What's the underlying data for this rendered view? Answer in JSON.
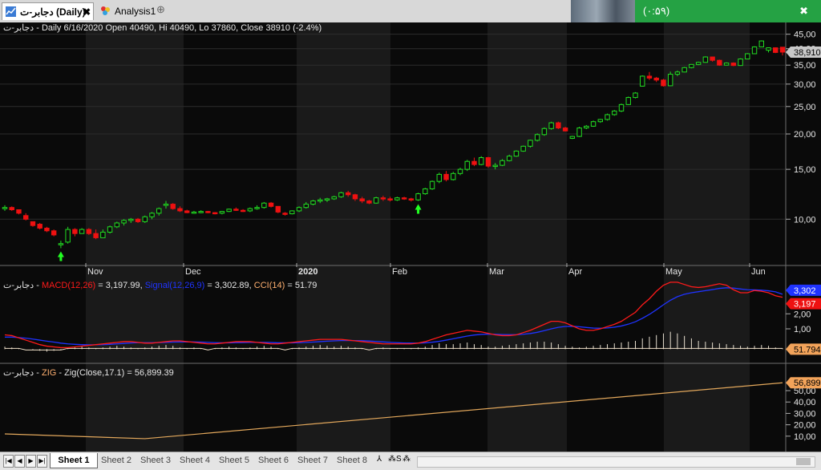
{
  "tabs": [
    {
      "label": "دجابر-ت (Daily)",
      "close": "✖",
      "active": true
    },
    {
      "label": "Analysis1",
      "active": false
    }
  ],
  "tab_add_icon": "⊕",
  "notification": {
    "text": "(۰:۵۹)",
    "close": "✖"
  },
  "pane1": {
    "header": "دجابر-ت - Daily 6/16/2020 Open 40490, Hi 40490, Lo 37860, Close 38910 (-2.4%)",
    "price_badge": "38,910"
  },
  "pane2": {
    "prefix": "دجابر-ت - ",
    "macd_label": "MACD(12,26)",
    "macd_value": " = 3,197.99, ",
    "signal_label": "Signal(12,26,9)",
    "signal_value": " = 3,302.89, ",
    "cci_label": "CCI(14)",
    "cci_value": " = 51.79",
    "badge_signal": "3,302",
    "badge_macd": "3,197",
    "badge_cci": "51.794"
  },
  "pane3": {
    "prefix": "دجابر-ت - ",
    "zig_label": "ZIG",
    "zig_rest": " - Zig(Close,17.1) = 56,899.39",
    "badge": "56,899"
  },
  "x_labels": [
    "Nov",
    "Dec",
    "2020",
    "Feb",
    "Mar",
    "Apr",
    "May",
    "Jun"
  ],
  "y1_ticks": [
    "45,00",
    "40,00",
    "35,00",
    "30,00",
    "25,00",
    "20,00",
    "15,00",
    "10,00"
  ],
  "y2_ticks": [
    "2,00",
    "1,00"
  ],
  "y3_ticks": [
    "50,00",
    "40,00",
    "30,00",
    "20,00",
    "10,00"
  ],
  "sheets": [
    "Sheet 1",
    "Sheet 2",
    "Sheet 3",
    "Sheet 4",
    "Sheet 5",
    "Sheet 6",
    "Sheet 7",
    "Sheet 8"
  ],
  "sheet_buttons": [
    "⅄",
    "⁂S",
    "⁂"
  ],
  "nav_buttons": [
    "|◀",
    "◀",
    "▶",
    "▶|"
  ],
  "colors": {
    "up": "#22dd22",
    "down": "#ee1111",
    "macd": "#ff1a1a",
    "signal": "#1f33ff",
    "cci": "#f0e0c8",
    "zig": "#e3a85c",
    "badge_price": "#c8c8c8",
    "badge_signal": "#1f33ff",
    "badge_macd": "#ee1111",
    "badge_orange": "#f2a35a"
  },
  "chart_data": {
    "type": "candlestick",
    "y_scale": "log",
    "ylim": [
      7000,
      47000
    ],
    "candles": [
      [
        10900,
        11200,
        10700,
        11000
      ],
      [
        11000,
        11100,
        10700,
        10800
      ],
      [
        10800,
        10800,
        10400,
        10500
      ],
      [
        10300,
        10500,
        9900,
        10000
      ],
      [
        9800,
        9800,
        9400,
        9500
      ],
      [
        9600,
        9700,
        9200,
        9300
      ],
      [
        9300,
        9400,
        9000,
        9100
      ],
      [
        9100,
        9200,
        8700,
        8800
      ],
      [
        8200,
        8400,
        7900,
        8200
      ],
      [
        8300,
        9400,
        8200,
        9200
      ],
      [
        9200,
        9300,
        8700,
        8900
      ],
      [
        8900,
        9300,
        8900,
        9200
      ],
      [
        9200,
        9300,
        8800,
        8900
      ],
      [
        8900,
        9200,
        8500,
        8600
      ],
      [
        8600,
        9200,
        8600,
        9000
      ],
      [
        9000,
        9500,
        8900,
        9400
      ],
      [
        9400,
        9800,
        9300,
        9700
      ],
      [
        9700,
        10000,
        9500,
        9900
      ],
      [
        9900,
        10100,
        9700,
        10000
      ],
      [
        10000,
        10100,
        9700,
        9800
      ],
      [
        9800,
        10300,
        9700,
        10200
      ],
      [
        10200,
        10600,
        10000,
        10500
      ],
      [
        10500,
        11000,
        10300,
        10900
      ],
      [
        11200,
        11600,
        10900,
        11300
      ],
      [
        11300,
        11400,
        10800,
        10900
      ],
      [
        10900,
        11100,
        10600,
        10700
      ],
      [
        10700,
        10800,
        10500,
        10550
      ],
      [
        10550,
        10700,
        10450,
        10600
      ],
      [
        10600,
        10750,
        10500,
        10650
      ],
      [
        10650,
        10700,
        10500,
        10550
      ],
      [
        10550,
        10600,
        10400,
        10500
      ],
      [
        10500,
        10700,
        10400,
        10650
      ],
      [
        10650,
        10900,
        10600,
        10850
      ],
      [
        10850,
        11000,
        10700,
        10750
      ],
      [
        10750,
        10850,
        10600,
        10700
      ],
      [
        10700,
        11000,
        10600,
        10900
      ],
      [
        10900,
        11200,
        10800,
        11000
      ],
      [
        11000,
        11500,
        10900,
        11400
      ],
      [
        11400,
        11500,
        11000,
        11100
      ],
      [
        11100,
        11100,
        10500,
        10600
      ],
      [
        10500,
        10600,
        10300,
        10450
      ],
      [
        10450,
        10750,
        10400,
        10700
      ],
      [
        10700,
        11100,
        10600,
        11000
      ],
      [
        11000,
        11500,
        10900,
        11300
      ],
      [
        11300,
        11700,
        11200,
        11600
      ],
      [
        11600,
        11900,
        11400,
        11700
      ],
      [
        11700,
        11900,
        11500,
        11800
      ],
      [
        11800,
        12100,
        11700,
        12000
      ],
      [
        12000,
        12500,
        11900,
        12400
      ],
      [
        12400,
        12600,
        12000,
        12200
      ],
      [
        12200,
        12300,
        11600,
        11800
      ],
      [
        11800,
        12000,
        11400,
        11600
      ],
      [
        11600,
        11700,
        11300,
        11400
      ],
      [
        11400,
        12000,
        11350,
        11900
      ],
      [
        11900,
        12100,
        11600,
        11800
      ],
      [
        11800,
        12000,
        11550,
        11700
      ],
      [
        11700,
        12000,
        11600,
        11900
      ],
      [
        11900,
        12000,
        11700,
        11800
      ],
      [
        11800,
        11900,
        11550,
        11700
      ],
      [
        11700,
        12400,
        11600,
        12300
      ],
      [
        12300,
        12900,
        12200,
        12800
      ],
      [
        12800,
        13700,
        12700,
        13600
      ],
      [
        13600,
        14600,
        13400,
        14400
      ],
      [
        14400,
        14800,
        13600,
        13800
      ],
      [
        13800,
        14700,
        13700,
        14500
      ],
      [
        14500,
        15200,
        14300,
        15000
      ],
      [
        15000,
        16200,
        14800,
        16000
      ],
      [
        16000,
        16500,
        15400,
        15600
      ],
      [
        15600,
        16700,
        15500,
        16500
      ],
      [
        16500,
        16600,
        15200,
        15400
      ],
      [
        15400,
        15800,
        15000,
        15500
      ],
      [
        15500,
        16300,
        15400,
        16100
      ],
      [
        16100,
        16900,
        16000,
        16700
      ],
      [
        16700,
        17500,
        16600,
        17400
      ],
      [
        17400,
        18200,
        17300,
        18100
      ],
      [
        18100,
        19100,
        17900,
        19000
      ],
      [
        19000,
        20100,
        18800,
        19900
      ],
      [
        19900,
        21100,
        19700,
        20900
      ],
      [
        20900,
        22100,
        20700,
        21900
      ],
      [
        21900,
        22100,
        20800,
        21000
      ],
      [
        21000,
        21200,
        20400,
        20500
      ],
      [
        19300,
        19700,
        19200,
        19600
      ],
      [
        19600,
        21200,
        19500,
        21000
      ],
      [
        21000,
        21500,
        20800,
        21300
      ],
      [
        21300,
        22300,
        21200,
        22100
      ],
      [
        22100,
        22600,
        21900,
        22500
      ],
      [
        22500,
        23600,
        22300,
        23400
      ],
      [
        23400,
        24300,
        23200,
        24100
      ],
      [
        24100,
        25600,
        23900,
        25400
      ],
      [
        25400,
        27100,
        25300,
        26900
      ],
      [
        26900,
        28100,
        26700,
        27900
      ],
      [
        29500,
        32200,
        29400,
        32000
      ],
      [
        32000,
        33100,
        31000,
        31500
      ],
      [
        31500,
        31800,
        30500,
        31000
      ],
      [
        31000,
        31300,
        29400,
        29600
      ],
      [
        29600,
        33200,
        29500,
        32500
      ],
      [
        32500,
        33500,
        32000,
        33100
      ],
      [
        33100,
        34500,
        33000,
        34300
      ],
      [
        34300,
        35300,
        34100,
        35200
      ],
      [
        35200,
        36000,
        35000,
        35800
      ],
      [
        35800,
        37600,
        35700,
        37400
      ],
      [
        37400,
        37500,
        36000,
        36400
      ],
      [
        36400,
        36600,
        34800,
        35000
      ],
      [
        35000,
        35800,
        34900,
        35600
      ],
      [
        35600,
        35800,
        34700,
        34900
      ],
      [
        34900,
        37000,
        34800,
        36800
      ],
      [
        36800,
        38600,
        36700,
        38400
      ],
      [
        38400,
        40800,
        38300,
        40600
      ],
      [
        40600,
        42800,
        40500,
        42600
      ],
      [
        39500,
        40400,
        38800,
        40300
      ],
      [
        40300,
        40400,
        38600,
        38800
      ],
      [
        40490,
        40490,
        37860,
        38910
      ]
    ],
    "signals": [
      {
        "index": 8,
        "type": "buy"
      },
      {
        "index": 59,
        "type": "buy"
      }
    ],
    "macd": [
      0.6,
      0.55,
      0.4,
      0.25,
      0.1,
      -0.05,
      -0.15,
      -0.2,
      -0.25,
      -0.25,
      -0.2,
      -0.15,
      -0.1,
      -0.05,
      0.0,
      0.05,
      0.1,
      0.15,
      0.15,
      0.1,
      0.05,
      0.05,
      0.1,
      0.15,
      0.2,
      0.2,
      0.15,
      0.1,
      0.05,
      0.0,
      0.0,
      0.05,
      0.1,
      0.15,
      0.15,
      0.15,
      0.1,
      0.05,
      0.0,
      0.0,
      0.05,
      0.1,
      0.15,
      0.2,
      0.25,
      0.3,
      0.3,
      0.3,
      0.3,
      0.25,
      0.2,
      0.15,
      0.1,
      0.05,
      0.0,
      0.0,
      0.0,
      0.0,
      0.0,
      0.05,
      0.15,
      0.3,
      0.45,
      0.6,
      0.7,
      0.8,
      0.9,
      0.85,
      0.8,
      0.7,
      0.6,
      0.55,
      0.55,
      0.6,
      0.75,
      0.9,
      1.1,
      1.3,
      1.5,
      1.5,
      1.4,
      1.2,
      1.0,
      0.9,
      0.9,
      1.0,
      1.15,
      1.3,
      1.5,
      1.8,
      2.1,
      2.6,
      3.0,
      3.5,
      3.9,
      4.1,
      4.1,
      3.95,
      3.8,
      3.75,
      3.8,
      3.9,
      4.0,
      3.9,
      3.6,
      3.4,
      3.4,
      3.55,
      3.5,
      3.4,
      3.2,
      3.1
    ],
    "signal": [
      0.45,
      0.45,
      0.42,
      0.38,
      0.32,
      0.25,
      0.18,
      0.12,
      0.05,
      0.0,
      -0.03,
      -0.05,
      -0.06,
      -0.06,
      -0.05,
      -0.03,
      0.0,
      0.03,
      0.06,
      0.08,
      0.08,
      0.08,
      0.09,
      0.1,
      0.12,
      0.13,
      0.13,
      0.13,
      0.12,
      0.1,
      0.08,
      0.07,
      0.07,
      0.08,
      0.09,
      0.1,
      0.1,
      0.1,
      0.09,
      0.07,
      0.07,
      0.07,
      0.08,
      0.1,
      0.12,
      0.15,
      0.18,
      0.2,
      0.22,
      0.23,
      0.22,
      0.21,
      0.19,
      0.16,
      0.13,
      0.1,
      0.08,
      0.06,
      0.05,
      0.05,
      0.07,
      0.11,
      0.17,
      0.25,
      0.34,
      0.43,
      0.52,
      0.59,
      0.63,
      0.65,
      0.64,
      0.62,
      0.61,
      0.61,
      0.64,
      0.69,
      0.77,
      0.88,
      1.0,
      1.1,
      1.16,
      1.17,
      1.14,
      1.09,
      1.05,
      1.04,
      1.06,
      1.11,
      1.19,
      1.31,
      1.47,
      1.7,
      1.96,
      2.27,
      2.6,
      2.9,
      3.14,
      3.3,
      3.4,
      3.47,
      3.54,
      3.61,
      3.69,
      3.73,
      3.71,
      3.65,
      3.6,
      3.59,
      3.57,
      3.53,
      3.46,
      3.3
    ],
    "cci_bars": [
      0.3,
      0.2,
      0.1,
      0.0,
      -0.1,
      -0.2,
      -0.3,
      -0.2,
      -0.1,
      0.1,
      0.2,
      0.3,
      0.2,
      0.1,
      0.2,
      0.3,
      0.4,
      0.3,
      0.2,
      0.1,
      0.2,
      0.3,
      0.4,
      0.5,
      0.4,
      0.2,
      0.1,
      0.2,
      0.1,
      0.0,
      0.1,
      0.2,
      0.3,
      0.2,
      0.1,
      0.2,
      0.3,
      0.4,
      0.3,
      0.1,
      0.0,
      0.1,
      0.2,
      0.3,
      0.4,
      0.5,
      0.4,
      0.3,
      0.4,
      0.3,
      0.2,
      0.1,
      0.0,
      0.1,
      0.2,
      0.1,
      0.1,
      0.1,
      0.1,
      0.2,
      0.3,
      0.5,
      0.7,
      0.6,
      0.6,
      0.7,
      0.8,
      0.6,
      0.5,
      0.3,
      0.3,
      0.4,
      0.5,
      0.6,
      0.7,
      0.8,
      0.9,
      0.9,
      0.8,
      0.6,
      0.4,
      0.3,
      0.2,
      0.3,
      0.4,
      0.5,
      0.6,
      0.7,
      0.8,
      0.9,
      1.0,
      1.3,
      1.5,
      1.7,
      1.9,
      2.1,
      1.9,
      1.6,
      1.3,
      1.0,
      0.9,
      0.8,
      0.7,
      0.6,
      0.5,
      0.4,
      0.3,
      0.4,
      0.5,
      0.4,
      0.2,
      0.1
    ],
    "zig": [
      {
        "i": 0,
        "v": 12000
      },
      {
        "i": 20,
        "v": 7800
      },
      {
        "i": 111,
        "v": 56899
      }
    ],
    "x_tick_index": {
      "Nov": 21,
      "Dec": 42,
      "2020": 67,
      "Feb": 88,
      "Mar": 110
    }
  }
}
